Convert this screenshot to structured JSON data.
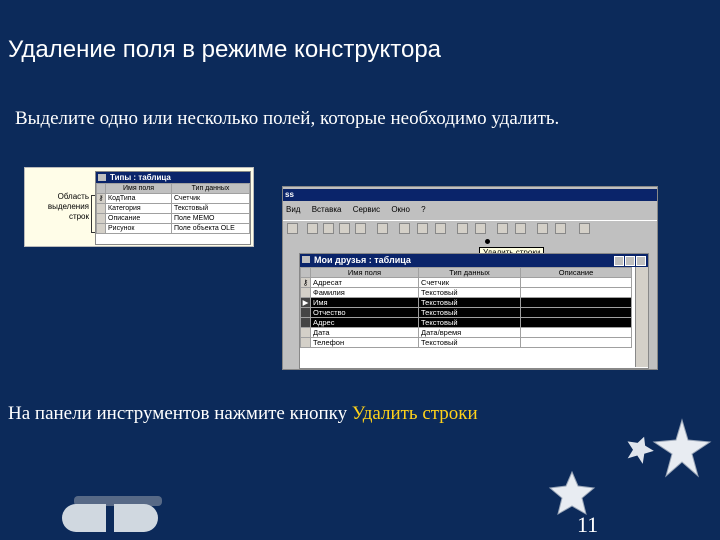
{
  "slide": {
    "title": "Удаление поля в режиме конструктора",
    "subtitle": "Выделите одно или несколько полей, которые необходимо удалить.",
    "instruction_prefix": "На панели инструментов нажмите кнопку ",
    "instruction_highlight": "Удалить строки",
    "page_number": "11",
    "colors": {
      "background": "#0c2a5a",
      "highlight": "#ffd21a"
    }
  },
  "small_window": {
    "label_line1": "Область",
    "label_line2": "выделения",
    "label_line3": "строк",
    "title": "Типы : таблица",
    "headers": [
      "Имя поля",
      "Тип данных"
    ],
    "rows": [
      [
        "КодТипа",
        "Счетчик"
      ],
      [
        "Категория",
        "Текстовый"
      ],
      [
        "Описание",
        "Поле MEMO"
      ],
      [
        "Рисунок",
        "Поле объекта OLE"
      ]
    ]
  },
  "big_window": {
    "app_title": "ss",
    "menu": [
      "Вид",
      "Вставка",
      "Сервис",
      "Окно",
      "?"
    ],
    "tooltip": "Удалить строки",
    "table_title": "Мои друзья : таблица",
    "headers": [
      "Имя поля",
      "Тип данных",
      "Описание"
    ],
    "rows": [
      {
        "name": "Адресат",
        "type": "Счетчик",
        "key": true,
        "selected": false
      },
      {
        "name": "Фамилия",
        "type": "Текстовый",
        "key": false,
        "selected": false
      },
      {
        "name": "Имя",
        "type": "Текстовый",
        "key": false,
        "selected": true
      },
      {
        "name": "Отчество",
        "type": "Текстовый",
        "key": false,
        "selected": true
      },
      {
        "name": "Адрес",
        "type": "Текстовый",
        "key": false,
        "selected": true
      },
      {
        "name": "Дата",
        "type": "Дата/время",
        "key": false,
        "selected": false
      },
      {
        "name": "Телефон",
        "type": "Текстовый",
        "key": false,
        "selected": false
      }
    ]
  },
  "nav": {
    "prev_icon": "nav-prev-icon",
    "next_icon": "nav-next-icon"
  }
}
